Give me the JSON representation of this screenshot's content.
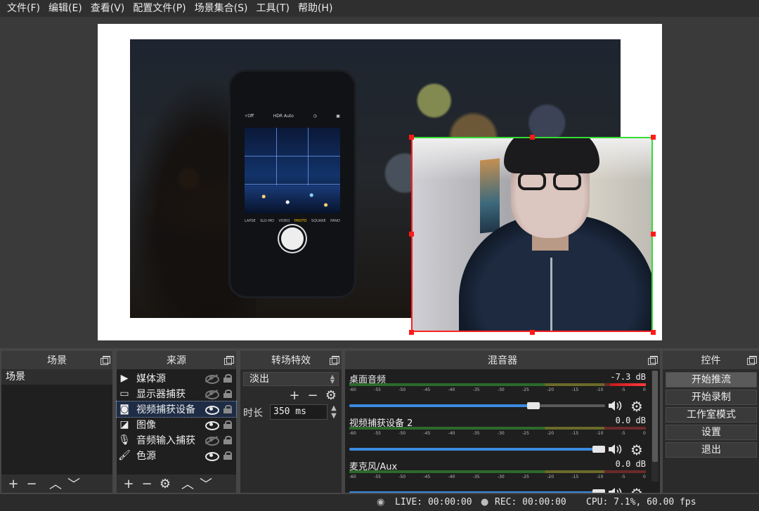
{
  "menu": [
    "文件(F)",
    "编辑(E)",
    "查看(V)",
    "配置文件(P)",
    "场景集合(S)",
    "工具(T)",
    "帮助(H)"
  ],
  "preview": {
    "phone_top": [
      "⚡Off",
      "HDR Auto",
      "◷",
      "▣"
    ],
    "phone_modes": [
      "LAPSE",
      "SLO-MO",
      "VIDEO",
      "PHOTO",
      "SQUARE",
      "PANO"
    ]
  },
  "scenes": {
    "title": "场景",
    "items": [
      "场景"
    ]
  },
  "sources": {
    "title": "来源",
    "items": [
      {
        "label": "媒体源",
        "icon": "play-icon",
        "visible": false
      },
      {
        "label": "显示器捕获",
        "icon": "monitor-icon",
        "visible": false
      },
      {
        "label": "视频捕获设备",
        "icon": "camera-icon",
        "visible": true,
        "selected": true
      },
      {
        "label": "图像",
        "icon": "image-icon",
        "visible": true
      },
      {
        "label": "音频输入捕获",
        "icon": "microphone-icon",
        "visible": false
      },
      {
        "label": "色源",
        "icon": "brush-icon",
        "visible": true
      }
    ]
  },
  "transitions": {
    "title": "转场特效",
    "selected": "淡出",
    "duration_label": "时长",
    "duration": "350 ms"
  },
  "mixer": {
    "title": "混音器",
    "ticks": [
      "-60",
      "-55",
      "-50",
      "-45",
      "-40",
      "-35",
      "-30",
      "-25",
      "-20",
      "-15",
      "-10",
      "-5",
      "0"
    ],
    "channels": [
      {
        "name": "桌面音频",
        "db": "-7.3 dB",
        "volume": 0.73,
        "level": 0.12
      },
      {
        "name": "视频捕获设备 2",
        "db": "0.0 dB",
        "volume": 1.0,
        "level": 0.0
      },
      {
        "name": "麦克风/Aux",
        "db": "0.0 dB",
        "volume": 1.0,
        "level": 0.0
      }
    ]
  },
  "controls": {
    "title": "控件",
    "buttons": [
      "开始推流",
      "开始录制",
      "工作室模式",
      "设置",
      "退出"
    ]
  },
  "status": {
    "live": "LIVE: 00:00:00",
    "rec": "REC: 00:00:00",
    "cpu": "CPU: 7.1%, 60.00 fps"
  },
  "colors": {
    "accent": "#3b8be0",
    "selected_row": "#1e2c45",
    "handle": "#ff1a1a"
  }
}
